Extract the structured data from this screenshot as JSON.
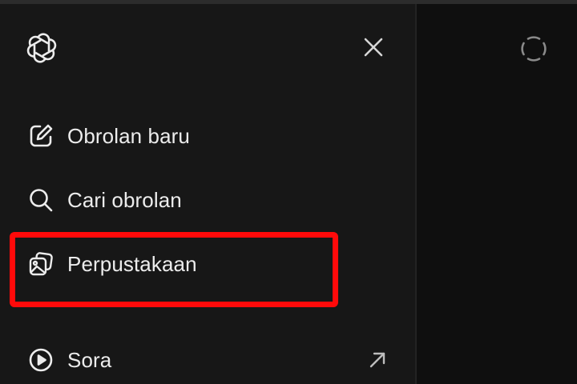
{
  "sidebar": {
    "items": [
      {
        "label": "Obrolan baru",
        "icon": "new-chat-icon"
      },
      {
        "label": "Cari obrolan",
        "icon": "search-icon"
      },
      {
        "label": "Perpustakaan",
        "icon": "library-icon"
      },
      {
        "label": "Sora",
        "icon": "play-circle-icon",
        "external_icon": "external-link-arrow-icon"
      }
    ],
    "logo_icon": "openai-logo-icon",
    "close_icon": "close-icon"
  },
  "header": {
    "temporary_chat_icon": "temporary-chat-icon"
  },
  "highlight": {
    "target": "Perpustakaan",
    "color": "#ff0a0a"
  },
  "colors": {
    "sidebar_bg": "#171717",
    "main_bg": "#0f0f0f",
    "text": "#ececec"
  }
}
